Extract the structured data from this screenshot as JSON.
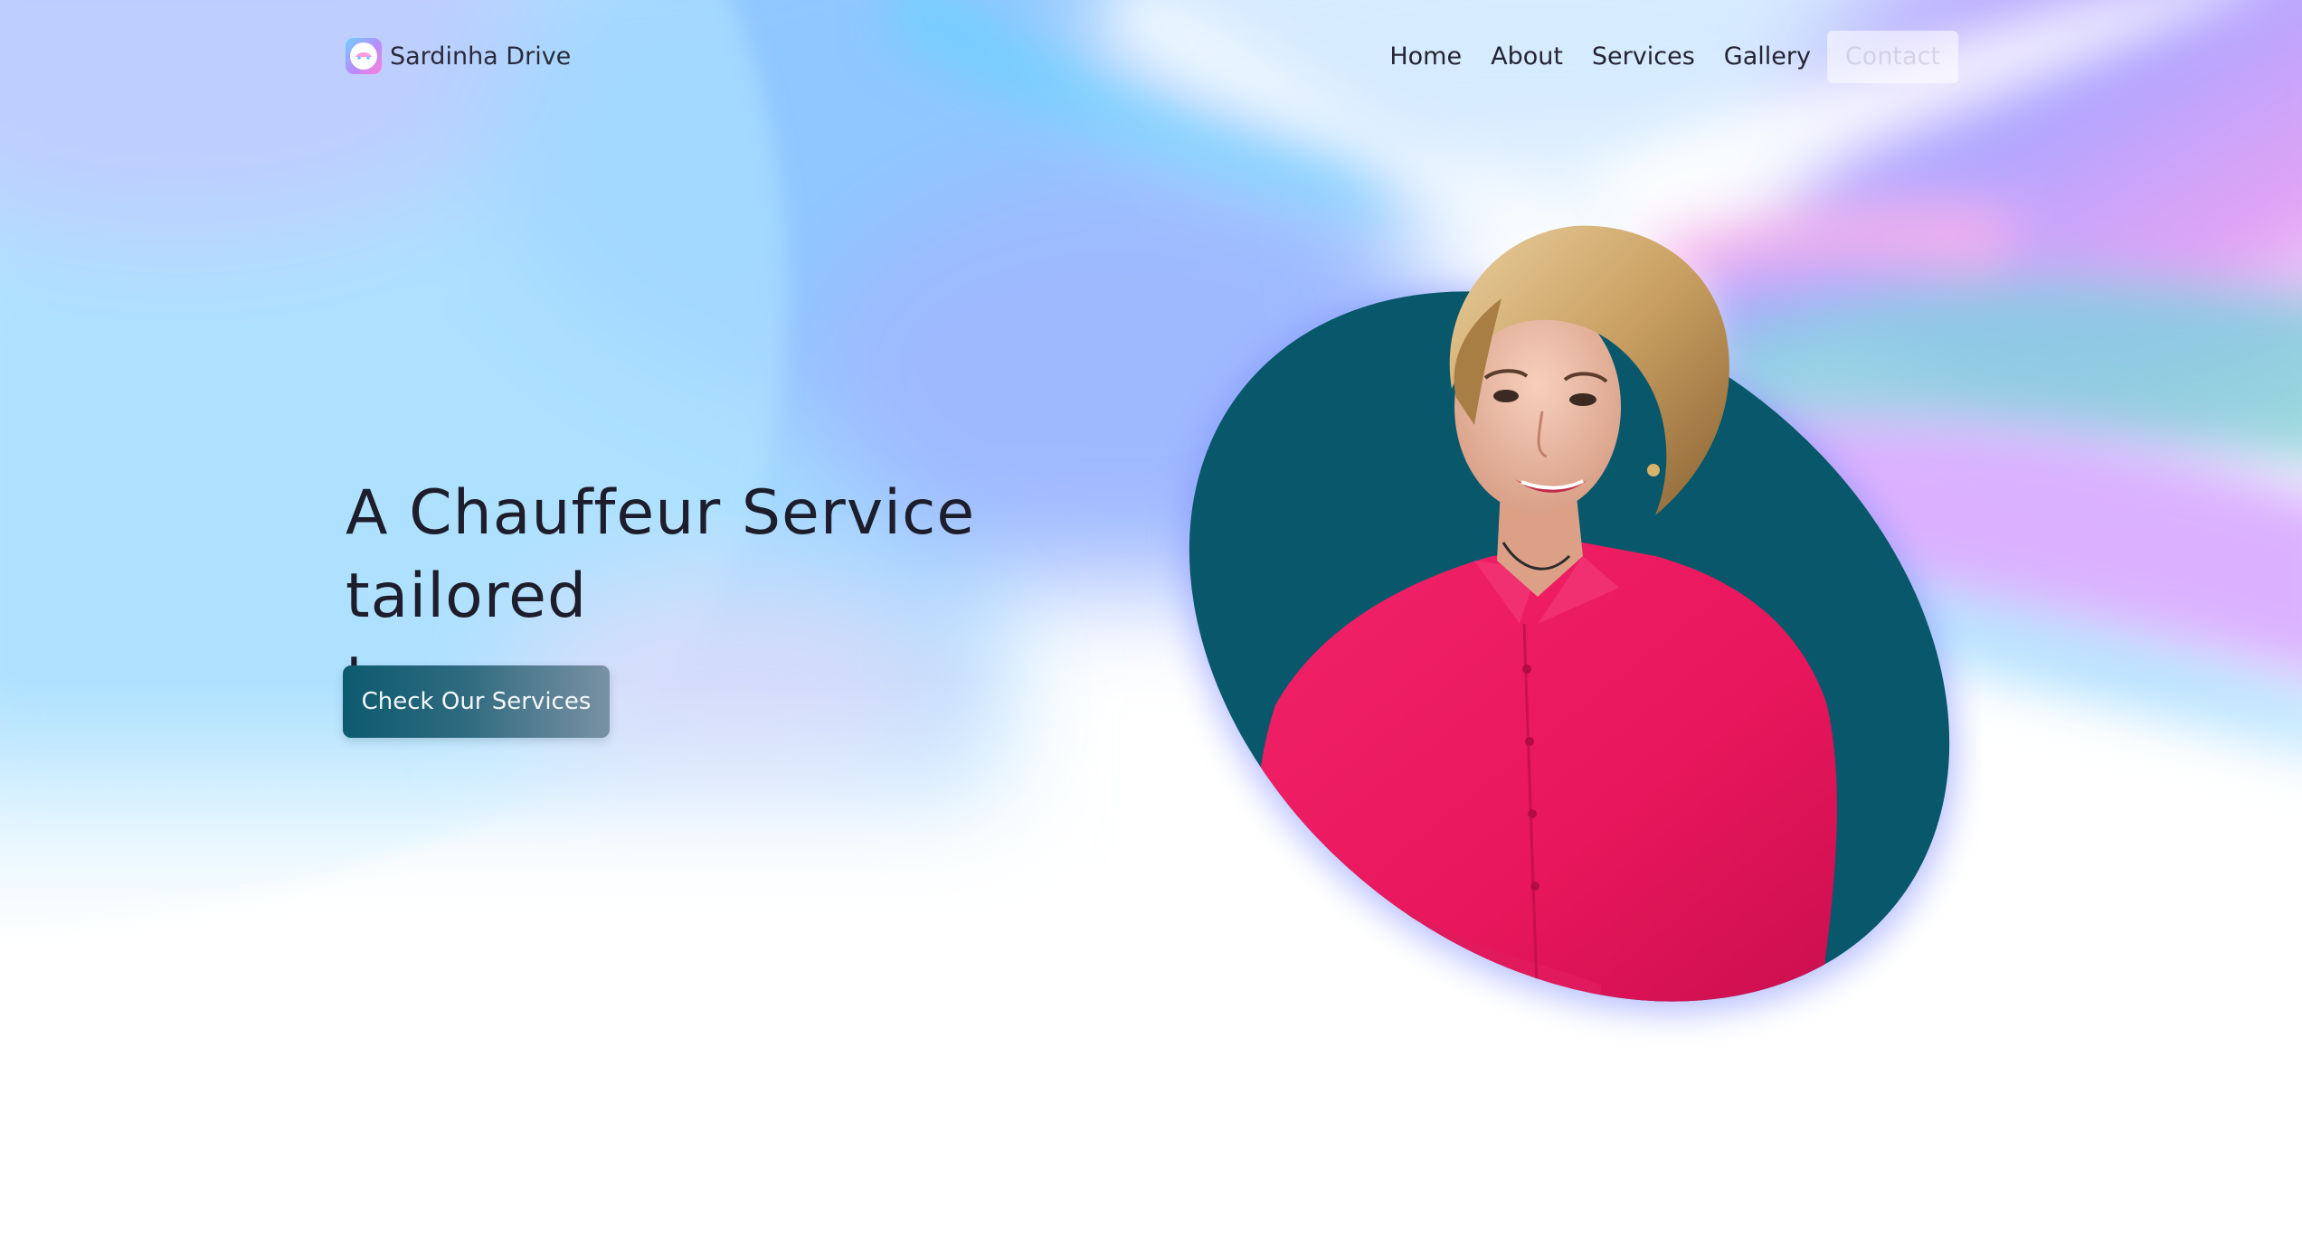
{
  "brand": {
    "name": "Sardinha Drive",
    "logo_icon": "car-badge-icon"
  },
  "nav": {
    "items": [
      {
        "label": "Home"
      },
      {
        "label": "About"
      },
      {
        "label": "Services"
      },
      {
        "label": "Gallery"
      },
      {
        "label": "Contact"
      }
    ]
  },
  "hero": {
    "title_line1": "A Chauffeur Service tailored",
    "title_line2": "to you.",
    "cta_label": "Check Our Services"
  },
  "portrait": {
    "icon": "portrait-photo"
  },
  "colors": {
    "accent_teal": "#08576a",
    "shirt_pink": "#ec1b62",
    "gradient_blue": "#7cc8ff",
    "gradient_violet": "#b59cff",
    "gradient_pink": "#f8a6ef",
    "text_dark": "#1d1d2b"
  }
}
